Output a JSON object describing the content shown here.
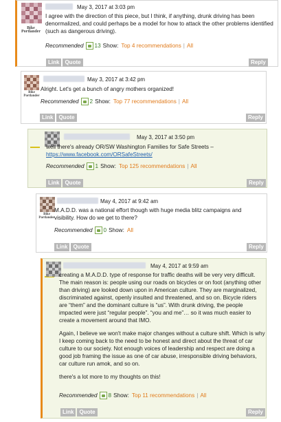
{
  "brand_logo": {
    "line1": "Bike",
    "line2": "Portlander"
  },
  "colors": {
    "accent": "#e88a1a",
    "link": "#1e5fae",
    "recommend_link": "#e07a1a",
    "button": "#b8b8b8",
    "highlight_bg": "#f3f6e6"
  },
  "labels": {
    "recommended": "Recommended",
    "show": "Show:",
    "all": "All",
    "link": "Link",
    "quote": "Quote",
    "reply": "Reply",
    "separator": "|"
  },
  "comments": [
    {
      "date": "May 3, 2017 at 3:03 pm",
      "paragraphs": [
        "I agree with the direction of this piece, but I think, if anything, drunk driving has been denormalized, and could perhaps be a model for how to attack the other problems identified (such as dangerous driving)."
      ],
      "count": "13",
      "top_link": "Top 4 recommendations"
    },
    {
      "date": "May 3, 2017 at 3:42 pm",
      "paragraphs": [
        "Alright. Let's get a bunch of angry mothers organized!"
      ],
      "count": "2",
      "top_link": "Top 77 recommendations"
    },
    {
      "date": "May 3, 2017 at 3:50 pm",
      "paragraphs": [
        "well there's already OR/SW Washington Families for Safe Streets –"
      ],
      "link_text": "https://www.facebook.com/ORSafeStreets/",
      "count": "1",
      "top_link": "Top 125 recommendations"
    },
    {
      "date": "May 4, 2017 at 9:42 am",
      "paragraphs": [
        "M.A.D.D. was a national effort though with huge media blitz campaigns and visibility. How do we get to there?"
      ],
      "count": "0",
      "top_link": ""
    },
    {
      "date": "May 4, 2017 at 9:59 am",
      "paragraphs": [
        "creating a M.A.D.D. type of response for traffic deaths will be very very difficult. The main reason is: people using our roads on bicycles or on foot (anything other than driving) are looked down upon in American culture. They are marginalized, discriminated against, openly insulted and threatened, and so on. Bicycle riders are “them” and the dominant culture is “us”. With drunk driving, the people impacted were just “regular people”. “you and me”… so it was much easier to create a movement around that IMO.",
        "Again, I believe we won't make major changes without a culture shift. Which is why I keep coming back to the need to be honest and direct about the threat of car culture to our society. Not enough voices of leadership and respect are doing a good job framing the issue as one of car abuse, irresponsible driving behaviors, car culture run amok, and so on.",
        "there's a lot more to my thoughts on this!"
      ],
      "count": "8",
      "top_link": "Top 11 recommendations"
    }
  ]
}
